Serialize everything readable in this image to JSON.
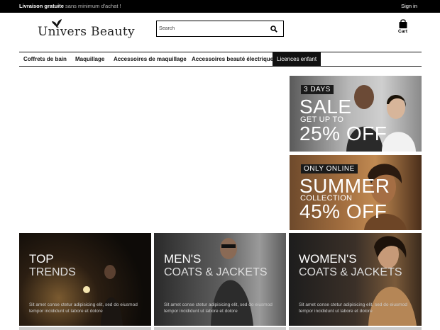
{
  "topbar": {
    "promo_bold": "Livraison gratuite",
    "promo_rest": "sans minimum d'achat !",
    "signin": "Sign in"
  },
  "logo": {
    "text": "Univers Beauty"
  },
  "search": {
    "placeholder": "Search"
  },
  "cart": {
    "label": "Cart"
  },
  "nav": {
    "items": [
      {
        "label": "Coffrets de bain"
      },
      {
        "label": "Maquillage"
      },
      {
        "label": "Accessoires de maquillage"
      },
      {
        "label": "Accessoires beauté électrique"
      },
      {
        "label": "Licences enfant"
      }
    ],
    "active_index": 4
  },
  "banners": [
    {
      "tag": "3 DAYS",
      "big": "SALE",
      "mid": "GET UP TO",
      "bottom": "25% OFF"
    },
    {
      "tag": "ONLY ONLINE",
      "big": "SUMMER",
      "mid": "COLLECTION",
      "bottom": "45% OFF"
    }
  ],
  "tiles": [
    {
      "line1": "TOP",
      "line2": "TRENDS",
      "desc": "Sit amet conse ctetur adipisicing elit, sed do eiusmod tempor incididunt ut labore et dolore"
    },
    {
      "line1": "MEN'S",
      "line2": "COATS & JACKETS",
      "desc": "Sit amet conse ctetur adipisicing elit, sed do eiusmod tempor incididunt ut labore et dolore"
    },
    {
      "line1": "WOMEN'S",
      "line2": "COATS & JACKETS",
      "desc": "Sit amet conse ctetur adipisicing elit, sed do eiusmod tempor incididunt ut labore et dolore"
    }
  ],
  "colors": {
    "bar": "#000000",
    "nav_active_bg": "#111111"
  }
}
